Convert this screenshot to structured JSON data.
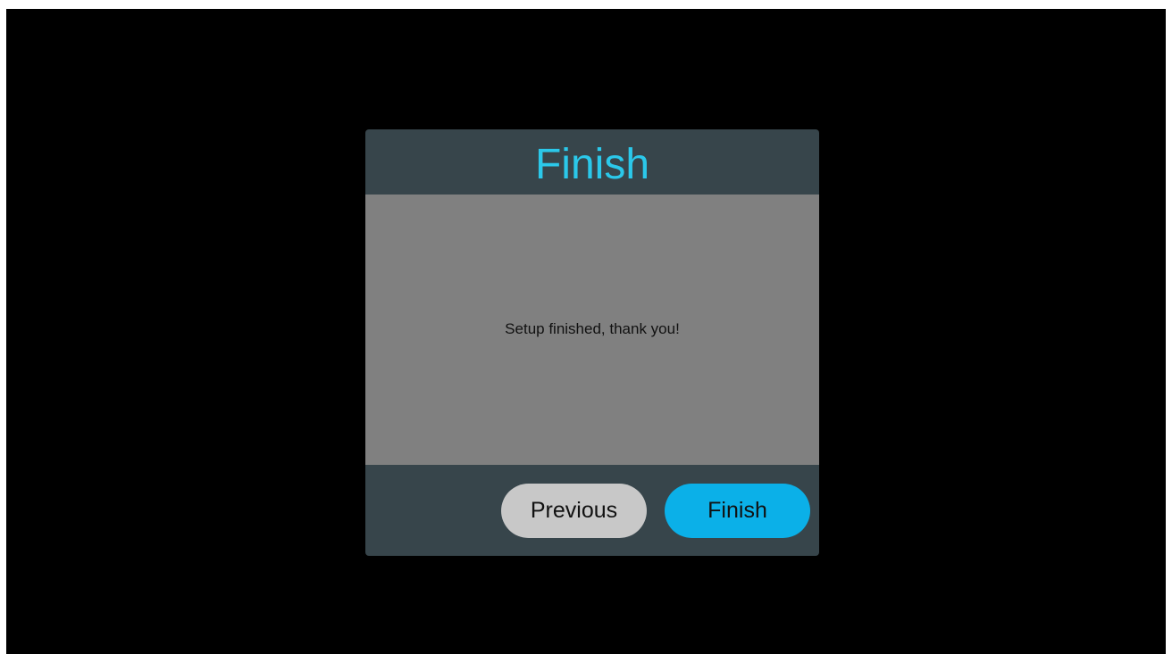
{
  "dialog": {
    "title": "Finish",
    "message": "Setup finished, thank you!",
    "buttons": {
      "previous_label": "Previous",
      "finish_label": "Finish"
    }
  },
  "colors": {
    "title": "#2bc8ea",
    "header_footer_bg": "#37454b",
    "body_bg": "#808080",
    "previous_bg": "#c8c8c8",
    "finish_bg": "#0bb0e8"
  }
}
